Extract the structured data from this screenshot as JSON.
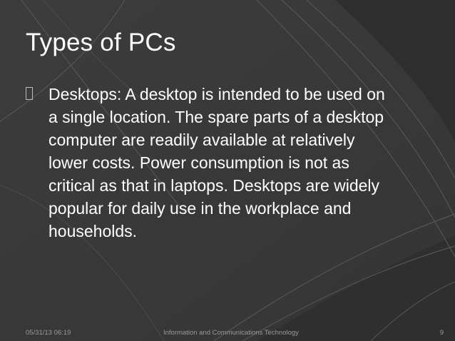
{
  "slide": {
    "title": "Types of PCs",
    "bullets": [
      {
        "text": "Desktops: A desktop is intended to be used on a single location. The spare parts of a desktop computer are readily available at relatively lower costs. Power consumption is not as critical as that in laptops. Desktops are widely popular for daily use in the workplace and households."
      }
    ]
  },
  "footer": {
    "date": "05/31/13 06:19",
    "center": "Information and Communications Technology",
    "page": "9"
  },
  "colors": {
    "background": "#3a3a3a",
    "text": "#ffffff",
    "footer_text": "#9a9a9a",
    "swoosh_lines": "#5a5a5a"
  }
}
